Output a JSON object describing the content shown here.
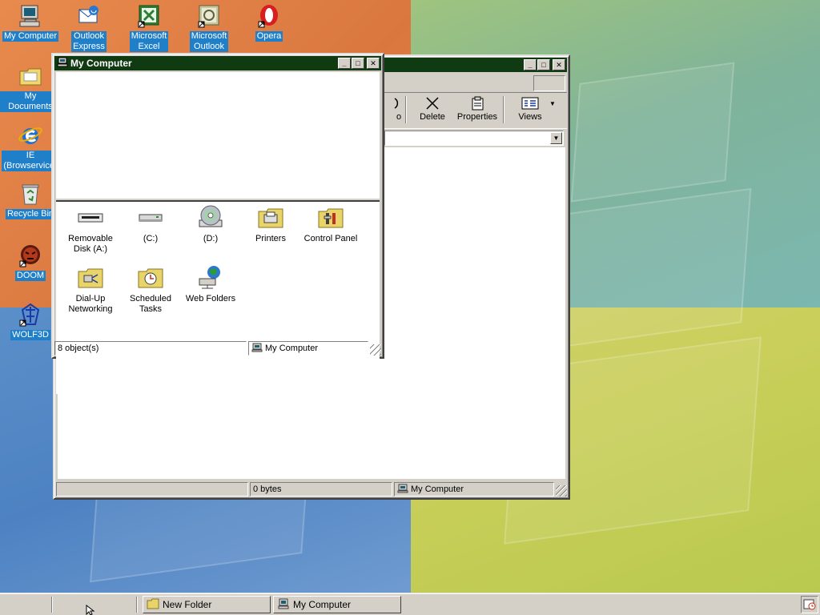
{
  "desktop": {
    "icons": [
      {
        "label": "My Computer",
        "icon": "computer-icon"
      },
      {
        "label": "Outlook\nExpress",
        "icon": "outlook-express-icon"
      },
      {
        "label": "Microsoft\nExcel",
        "icon": "excel-icon"
      },
      {
        "label": "Microsoft\nOutlook",
        "icon": "outlook-icon"
      },
      {
        "label": "Opera",
        "icon": "opera-icon"
      },
      {
        "label": "My Documents",
        "icon": "folder-icon"
      },
      {
        "label": "IE\n(Browservice)",
        "icon": "internet-explorer-icon"
      },
      {
        "label": "Recycle Bin",
        "icon": "recycle-bin-icon"
      },
      {
        "label": "DOOM",
        "icon": "doom-icon"
      },
      {
        "label": "WOLF3D",
        "icon": "wolf3d-icon"
      }
    ]
  },
  "folder_window": {
    "toolbar": {
      "undo_label": "o",
      "delete_label": "Delete",
      "properties_label": "Properties",
      "views_label": "Views"
    },
    "status": {
      "size": "0 bytes",
      "location": "My Computer"
    }
  },
  "mycomputer_window": {
    "title": "My Computer",
    "items": [
      {
        "label": "Removable\nDisk (A:)",
        "icon": "floppy-drive-icon"
      },
      {
        "label": "(C:)",
        "icon": "hard-drive-icon"
      },
      {
        "label": "(D:)",
        "icon": "cd-drive-icon"
      },
      {
        "label": "Printers",
        "icon": "printers-folder-icon"
      },
      {
        "label": "Control Panel",
        "icon": "control-panel-icon"
      },
      {
        "label": "Dial-Up\nNetworking",
        "icon": "dialup-networking-icon"
      },
      {
        "label": "Scheduled\nTasks",
        "icon": "scheduled-tasks-icon"
      },
      {
        "label": "Web Folders",
        "icon": "web-folders-icon"
      }
    ],
    "status": {
      "count": "8 object(s)",
      "location": "My Computer"
    }
  },
  "taskbar": {
    "tasks": [
      {
        "label": "New Folder",
        "icon": "folder-icon"
      },
      {
        "label": "My Computer",
        "icon": "computer-icon"
      }
    ]
  },
  "colors": {
    "titlebar_dark_green": "#0f3a12",
    "selection_blue": "#1f7fc9",
    "window_face": "#d4d0c8"
  }
}
